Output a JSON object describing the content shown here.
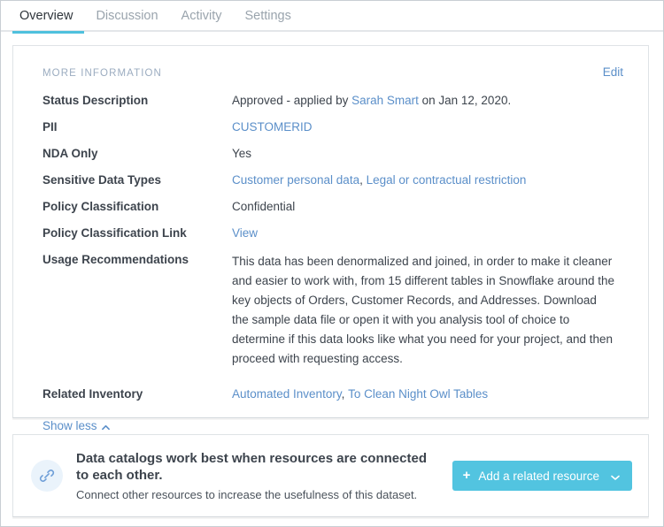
{
  "tabs": [
    {
      "label": "Overview",
      "active": true
    },
    {
      "label": "Discussion",
      "active": false
    },
    {
      "label": "Activity",
      "active": false
    },
    {
      "label": "Settings",
      "active": false
    }
  ],
  "info_card": {
    "section_title": "MORE INFORMATION",
    "edit_label": "Edit",
    "rows": [
      {
        "label": "Status Description",
        "value_prefix": "Approved - applied by ",
        "value_link": "Sarah Smart",
        "value_suffix": " on Jan 12, 2020."
      },
      {
        "label": "PII",
        "links": [
          "CUSTOMERID"
        ]
      },
      {
        "label": "NDA Only",
        "value": "Yes"
      },
      {
        "label": "Sensitive Data Types",
        "links": [
          "Customer personal data",
          "Legal or contractual restriction"
        ]
      },
      {
        "label": "Policy Classification",
        "value": "Confidential"
      },
      {
        "label": "Policy Classification Link",
        "links": [
          "View"
        ]
      },
      {
        "label": "Usage Recommendations",
        "value": "This data has been denormalized and joined, in order to make it cleaner and easier to work with, from 15 different tables in Snowflake around the key objects of Orders, Customer Records, and Addresses. Download the sample data file or open it with you analysis tool of choice to determine if this data looks like what you need for your project, and then proceed with requesting access."
      },
      {
        "label": "Related Inventory",
        "links": [
          "Automated Inventory",
          "To Clean Night Owl Tables"
        ]
      }
    ],
    "show_less_label": "Show less",
    "show_less_icon": "chevron-up-icon"
  },
  "related_card": {
    "icon": "link-icon",
    "title": "Data catalogs work best when resources are connected to each other.",
    "subtitle": "Connect other resources to increase the usefulness of this dataset.",
    "button": {
      "plus_icon": "plus-icon",
      "label": "Add a related resource",
      "chevron_icon": "chevron-down-icon"
    }
  },
  "colors": {
    "accent": "#52c4e0",
    "tab_underline": "#4fc0dd",
    "link": "#5b8fc9",
    "section_title": "#9bacc0",
    "text": "#3d444d",
    "card_border": "#dfe3e6",
    "badge_bg": "#eaf3fb"
  }
}
